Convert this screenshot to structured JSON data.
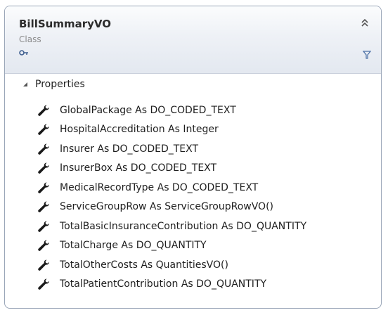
{
  "class_box": {
    "name": "BillSummaryVO",
    "stereotype": "Class",
    "collapse_icon": "double-chevron-up-icon",
    "key_icon": "key-icon",
    "filter_icon": "filter-icon"
  },
  "compartment": {
    "label": "Properties",
    "expand_icon": "expanded-triangle-icon",
    "member_icon": "wrench-icon",
    "properties": [
      "GlobalPackage As DO_CODED_TEXT",
      "HospitalAccreditation As Integer",
      "Insurer As DO_CODED_TEXT",
      "InsurerBox As DO_CODED_TEXT",
      "MedicalRecordType As DO_CODED_TEXT",
      "ServiceGroupRow As ServiceGroupRowVO()",
      "TotalBasicInsuranceContribution As DO_QUANTITY",
      "TotalCharge As DO_QUANTITY",
      "TotalOtherCosts As QuantitiesVO()",
      "TotalPatientContribution As DO_QUANTITY"
    ]
  },
  "colors": {
    "border": "#9aa6b8",
    "header_top": "#fbfcfd",
    "header_bottom": "#e3e8f0",
    "icon": "#1a1a1a",
    "filter": "#4a6fa5"
  }
}
